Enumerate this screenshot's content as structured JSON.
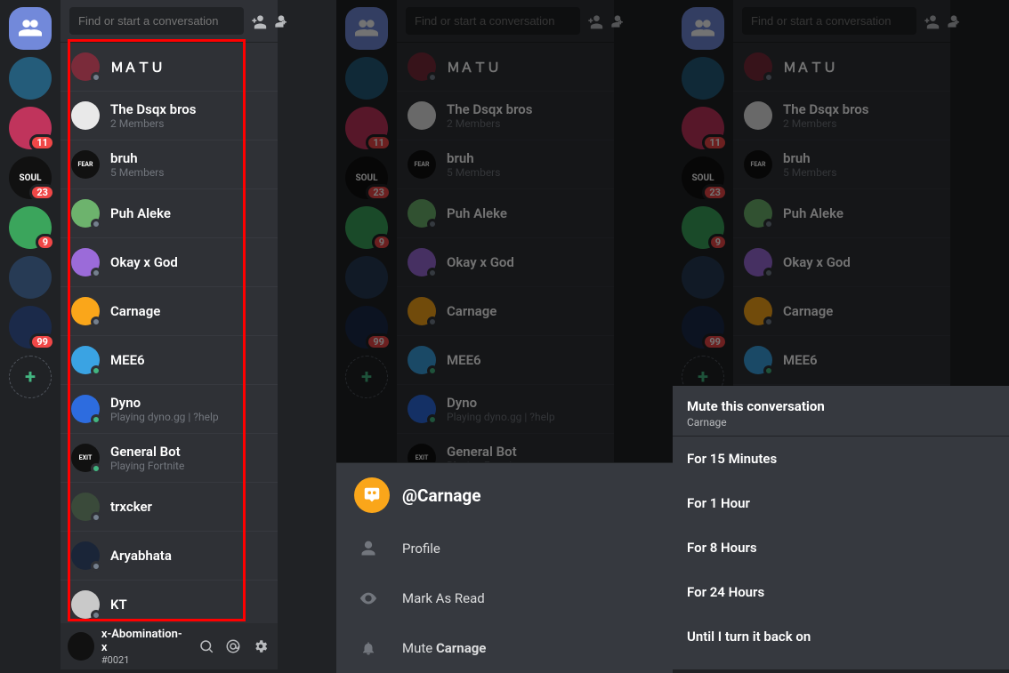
{
  "search_placeholder": "Find or start a conversation",
  "guilds": [
    {
      "id": "home",
      "color": "#7289da",
      "label": "",
      "badge": null,
      "shape": "home"
    },
    {
      "id": "g1",
      "color": "#245c7a",
      "label": "",
      "badge": null
    },
    {
      "id": "g2",
      "color": "#c0345c",
      "label": "",
      "badge": "11"
    },
    {
      "id": "g3",
      "color": "#111",
      "label": "SOUL",
      "badge": "23"
    },
    {
      "id": "g4",
      "color": "#3ba55c",
      "label": "",
      "badge": "9"
    },
    {
      "id": "g5",
      "color": "#273b55",
      "label": "",
      "badge": null
    },
    {
      "id": "g6",
      "color": "#1b2a4a",
      "label": "",
      "badge": "99"
    },
    {
      "id": "add",
      "color": "transparent",
      "label": "+",
      "badge": null,
      "shape": "add"
    }
  ],
  "conversations": [
    {
      "name": "ＭＡＴＵ",
      "sub": "",
      "av": "#7a2b3a",
      "status": "offline"
    },
    {
      "name": "The Dsqx bros",
      "sub": "2 Members",
      "av": "#e9e9e9",
      "status": "none"
    },
    {
      "name": "bruh",
      "sub": "5 Members",
      "av": "#111",
      "status": "none",
      "avlabel": "FEAR.NO"
    },
    {
      "name": "Puh Aleke",
      "sub": "",
      "av": "#6db36d",
      "status": "offline"
    },
    {
      "name": "Okay x God",
      "sub": "",
      "av": "#9b6bd9",
      "status": "offline"
    },
    {
      "name": "Carnage",
      "sub": "",
      "av": "#faa61a",
      "status": "offline"
    },
    {
      "name": "MEE6",
      "sub": "",
      "av": "#3aa3e3",
      "status": "online"
    },
    {
      "name": "Dyno",
      "sub": "Playing dyno.gg | ?help",
      "av": "#2d6cdf",
      "status": "online"
    },
    {
      "name": "General Bot",
      "sub": "Playing Fortnite",
      "av": "#111",
      "status": "online",
      "avlabel": "EXIT"
    },
    {
      "name": "trxcker",
      "sub": "",
      "av": "#3a4a3a",
      "status": "offline"
    },
    {
      "name": "Aryabhata",
      "sub": "",
      "av": "#1a2538",
      "status": "offline"
    },
    {
      "name": "KT",
      "sub": "",
      "av": "#c9c9c9",
      "status": "offline"
    }
  ],
  "user": {
    "name": "x-Abomination-x",
    "tag": "#0021"
  },
  "context": {
    "target": "@Carnage",
    "items": [
      {
        "icon": "person",
        "label": "Profile"
      },
      {
        "icon": "eye",
        "label": "Mark As Read"
      },
      {
        "icon": "bell",
        "label": "Mute Carnage"
      }
    ]
  },
  "mute": {
    "title": "Mute this conversation",
    "subtitle": "Carnage",
    "options": [
      "For 15 Minutes",
      "For 1 Hour",
      "For 8 Hours",
      "For 24 Hours",
      "Until I turn it back on"
    ]
  }
}
